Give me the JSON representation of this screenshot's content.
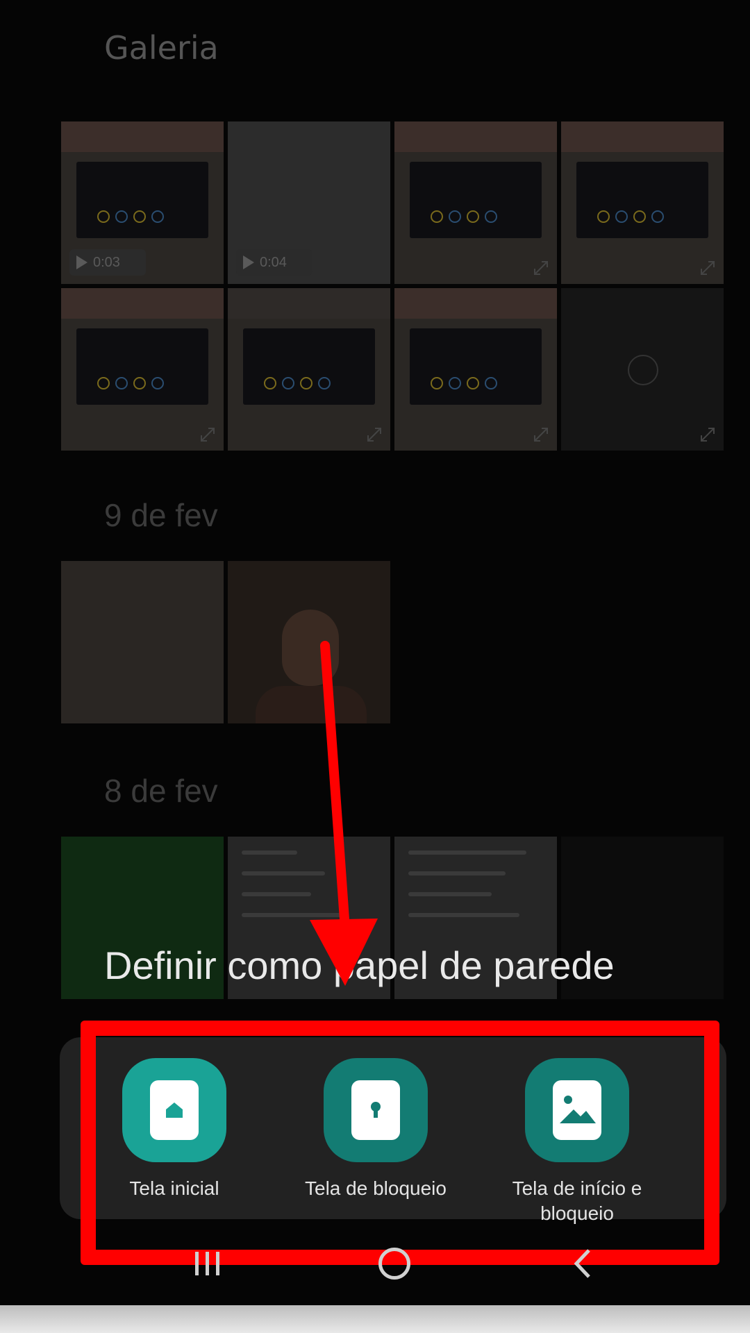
{
  "gallery": {
    "title": "Galeria",
    "videos": [
      {
        "duration": "0:03"
      },
      {
        "duration": "0:04"
      }
    ],
    "sections": [
      {
        "label": "9 de fev"
      },
      {
        "label": "8 de fev"
      }
    ]
  },
  "sheet": {
    "title": "Definir como papel de parede",
    "options": [
      {
        "label": "Tela inicial",
        "icon": "home-screen-icon"
      },
      {
        "label": "Tela de bloqueio",
        "icon": "lock-screen-icon"
      },
      {
        "label": "Tela de início e bloqueio",
        "icon": "home-and-lock-screen-icon"
      }
    ]
  },
  "navbar": {
    "items": [
      "recent-apps",
      "home",
      "back"
    ]
  },
  "colors": {
    "highlight": "#ff0000",
    "teal": "#1aa396",
    "teal_dark": "#137c73",
    "sheet_bg": "#222222"
  }
}
